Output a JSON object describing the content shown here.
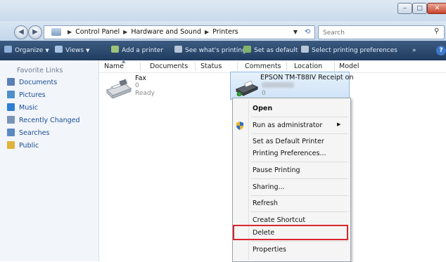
{
  "window": {
    "minimize_icon": "minimize-icon",
    "maximize_icon": "maximize-icon",
    "close_icon": "close-icon",
    "min_glyph": "‒",
    "max_glyph": "□",
    "close_glyph": "✕"
  },
  "address": {
    "breadcrumbs": [
      "Control Panel",
      "Hardware and Sound",
      "Printers"
    ],
    "back_glyph": "◀",
    "fwd_glyph": "▶",
    "search_placeholder": "Search"
  },
  "toolbar": {
    "organize": "Organize",
    "views": "Views",
    "add_printer": "Add a printer",
    "see_printing": "See what's printing",
    "set_default": "Set as default",
    "select_prefs": "Select printing preferences",
    "overflow": "»",
    "help": "?"
  },
  "sidebar": {
    "title": "Favorite Links",
    "items": [
      {
        "label": "Documents",
        "color": "#5a7fb8"
      },
      {
        "label": "Pictures",
        "color": "#4e8fc9"
      },
      {
        "label": "Music",
        "color": "#2f7fd0"
      },
      {
        "label": "Recently Changed",
        "color": "#7a94b8"
      },
      {
        "label": "Searches",
        "color": "#5b89c4"
      },
      {
        "label": "Public",
        "color": "#e1b23a"
      }
    ]
  },
  "columns": [
    "Name",
    "Documents",
    "Status",
    "Comments",
    "Location",
    "Model"
  ],
  "printers": [
    {
      "name": "Fax",
      "count": "0",
      "status": "Ready"
    },
    {
      "name": "EPSON TM-T88IV Receipt on",
      "count": "0"
    }
  ],
  "context_menu": {
    "items": [
      "Open",
      "Run as administrator",
      "Set as Default Printer",
      "Printing Preferences...",
      "Pause Printing",
      "Sharing...",
      "Refresh",
      "Create Shortcut",
      "Delete",
      "Properties"
    ]
  },
  "colors": {
    "highlight_box": "#d9262e",
    "selection": "#cfe3f7",
    "command_bar": "#2b4a70"
  }
}
